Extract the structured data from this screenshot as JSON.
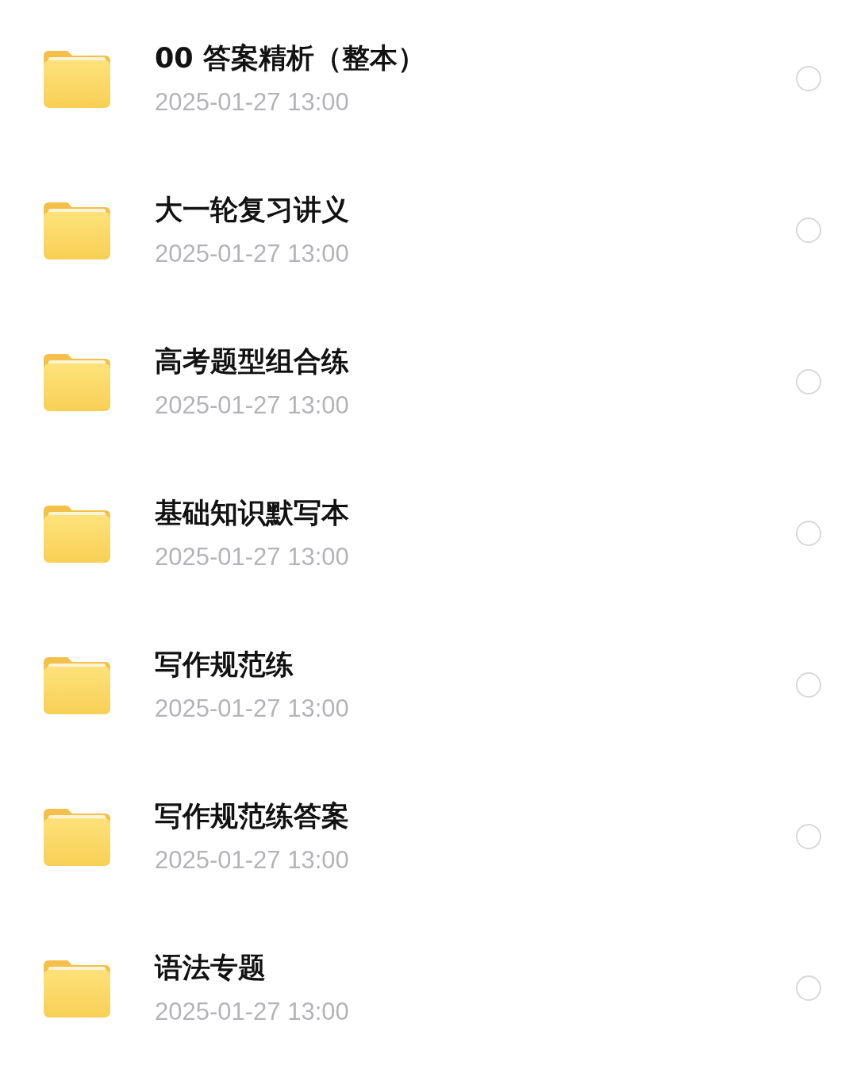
{
  "files": [
    {
      "name": "00 答案精析（整本）",
      "date": "2025-01-27 13:00",
      "selected": false
    },
    {
      "name": "大一轮复习讲义",
      "date": "2025-01-27 13:00",
      "selected": false
    },
    {
      "name": "高考题型组合练",
      "date": "2025-01-27 13:00",
      "selected": false
    },
    {
      "name": "基础知识默写本",
      "date": "2025-01-27 13:00",
      "selected": false
    },
    {
      "name": "写作规范练",
      "date": "2025-01-27 13:00",
      "selected": false
    },
    {
      "name": "写作规范练答案",
      "date": "2025-01-27 13:00",
      "selected": false
    },
    {
      "name": "语法专题",
      "date": "2025-01-27 13:00",
      "selected": false
    }
  ]
}
